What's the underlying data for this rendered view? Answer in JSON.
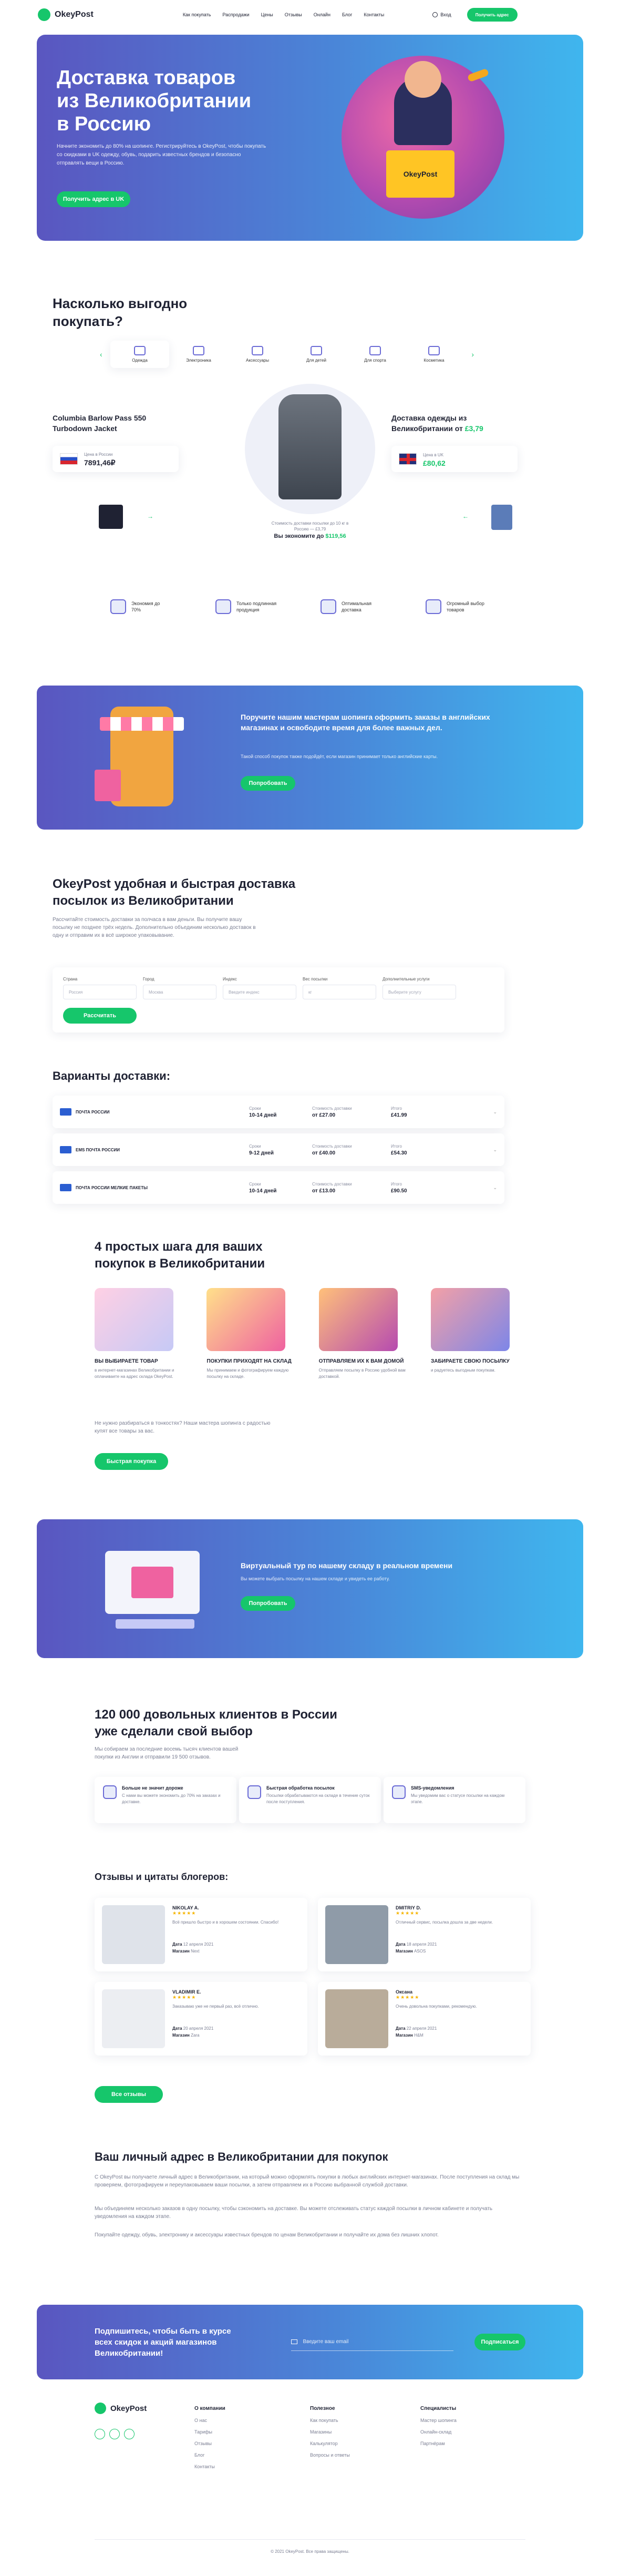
{
  "header": {
    "logo": "OkeyPost",
    "nav": [
      "Как покупать",
      "Распродажи",
      "Цены",
      "Отзывы",
      "Онлайн",
      "Блог",
      "Контакты"
    ],
    "login": "Вход",
    "cta": "Получить адрес"
  },
  "hero": {
    "title_line1": "Доставка товаров",
    "title_line2": "из Великобритании",
    "title_line3": "в Россию",
    "text": "Начните экономить до 80% на шопинге. Регистрируйтесь в OkeyPost, чтобы покупать со скидками в UK одежду, обувь, подарить известных брендов и безопасно отправлять вещи в Россию.",
    "cta": "Получить адрес в UK",
    "box_label": "OkeyPost"
  },
  "profit": {
    "title_line1": "Насколько выгодно",
    "title_line2": "покупать?",
    "categories": [
      "Одежда",
      "Электроника",
      "Аксессуары",
      "Для детей",
      "Для спорта",
      "Косметика"
    ],
    "product_name": "Columbia Barlow Pass 550 Turbodown Jacket",
    "ru_price_label": "Цена в России",
    "ru_price": "7891,46₽",
    "uk_label": "Доставка одежды из Великобритании от",
    "uk_from": "£3,79",
    "uk_price_label": "Цена в UK",
    "uk_price": "£80,62",
    "compare_note": "Стоимость доставки посылки до 10 кг в Россию — £3,79",
    "savings_label": "Вы экономите до",
    "savings": "$119,56"
  },
  "features": [
    "Экономия до 70%",
    "Только подлинная продукция",
    "Оптимальная доставка",
    "Огромный выбор товаров"
  ],
  "shopper_banner": {
    "title": "Поручите нашим мастерам шопинга оформить заказы в английских магазинах и освободите время для более важных дел.",
    "text": "Такой способ покупок также подойдёт, если магазин принимает только английские карты.",
    "cta": "Попробовать"
  },
  "calculator": {
    "title_line1": "OkeyPost удобная и быстрая доставка",
    "title_line2": "посылок из Великобритании",
    "text": "Рассчитайте стоимость доставки за полчаса в вам деньги. Вы получите вашу посылку не позднее трёх недель. Дополнительно объединим несколько доставок в одну и отправим их в всё широкое упаковывание.",
    "fields": [
      {
        "label": "Страна",
        "placeholder": "Россия"
      },
      {
        "label": "Город",
        "placeholder": "Москва"
      },
      {
        "label": "Индекс",
        "placeholder": "Введите индекс"
      },
      {
        "label": "Вес посылки",
        "placeholder": "кг"
      },
      {
        "label": "Дополнительные услуги",
        "placeholder": "Выберите услугу"
      }
    ],
    "cta": "Рассчитать"
  },
  "delivery": {
    "title": "Варианты доставки:",
    "headers": {
      "term": "Сроки",
      "cost": "Стоимость доставки",
      "total": "Итого"
    },
    "rows": [
      {
        "name": "ПОЧТА РОССИИ",
        "term": "10-14 дней",
        "cost": "от £27.00",
        "total": "£41.99"
      },
      {
        "name": "EMS ПОЧТА РОССИИ",
        "term": "9-12 дней",
        "cost": "от £40.00",
        "total": "£54.30"
      },
      {
        "name": "ПОЧТА РОССИИ МЕЛКИЕ ПАКЕТЫ",
        "term": "10-14 дней",
        "cost": "от £13.00",
        "total": "£90.50"
      }
    ]
  },
  "steps": {
    "title_line1": "4 простых шага для ваших",
    "title_line2": "покупок в Великобритании",
    "items": [
      {
        "title": "ВЫ ВЫБИРАЕТЕ ТОВАР",
        "text": "в интернет-магазинах Великобритании и оплачиваете на адрес склада OkeyPost."
      },
      {
        "title": "ПОКУПКИ ПРИХОДЯТ НА СКЛАД",
        "text": "Мы принимаем и фотографируем каждую посылку на складе."
      },
      {
        "title": "ОТПРАВЛЯЕМ ИХ К ВАМ ДОМОЙ",
        "text": "Отправляем посылку в Россию удобной вам доставкой."
      },
      {
        "title": "ЗАБИРАЕТЕ СВОЮ ПОСЫЛКУ",
        "text": "и радуетесь выгодным покупкам."
      }
    ],
    "note": "Не нужно разбираться в тонкостях? Наши мастера шопинга с радостью купят все товары за вас.",
    "cta": "Быстрая покупка"
  },
  "tour_banner": {
    "title": "Виртуальный тур по нашему складу в реальном времени",
    "text": "Вы можете выбрать посылку на нашем складе и увидеть ее работу.",
    "cta": "Попробовать"
  },
  "clients": {
    "title_line1": "120 000 довольных клиентов в России",
    "title_line2": "уже сделали свой выбор",
    "text": "Мы собираем за последние восемь тысяч клиентов вашей покупки из Англии и отправили 19 500 отзывов.",
    "advantages": [
      {
        "title": "Больше не значит дороже",
        "text": "С нами вы можете экономить до 70% на заказах и доставке."
      },
      {
        "title": "Быстрая обработка посылок",
        "text": "Посылки обрабатываются на складе в течение суток после поступления."
      },
      {
        "title": "SMS-уведомления",
        "text": "Мы уведомим вас о статусе посылки на каждом этапе."
      }
    ]
  },
  "reviews": {
    "title": "Отзывы и цитаты блогеров:",
    "items": [
      {
        "name": "NIKOLAY A.",
        "text": "Всё пришло быстро и в хорошем состоянии. Спасибо!",
        "date": "12 апреля 2021",
        "shop": "Next"
      },
      {
        "name": "DMITRIY D.",
        "text": "Отличный сервис, посылка дошла за две недели.",
        "date": "18 апреля 2021",
        "shop": "ASOS"
      },
      {
        "name": "VLADIMIR E.",
        "text": "Заказываю уже не первый раз, всё отлично.",
        "date": "20 апреля 2021",
        "shop": "Zara"
      },
      {
        "name": "Оксана",
        "text": "Очень довольна покупками, рекомендую.",
        "date": "22 апреля 2021",
        "shop": "H&M"
      }
    ],
    "date_label": "Дата",
    "shop_label": "Магазин",
    "cta": "Все отзывы"
  },
  "address": {
    "title": "Ваш личный адрес в Великобритании для покупок",
    "p1": "С OkeyPost вы получаете личный адрес в Великобритании, на который можно оформлять покупки в любых английских интернет-магазинах. После поступления на склад мы проверяем, фотографируем и переупаковываем ваши посылки, а затем отправляем их в Россию выбранной службой доставки.",
    "p2": "Мы объединяем несколько заказов в одну посылку, чтобы сэкономить на доставке. Вы можете отслеживать статус каждой посылки в личном кабинете и получать уведомления на каждом этапе.",
    "p3": "Покупайте одежду, обувь, электронику и аксессуары известных брендов по ценам Великобритании и получайте их дома без лишних хлопот."
  },
  "subscribe": {
    "title": "Подпишитесь, чтобы быть в курсе всех скидок и акций магазинов Великобритании!",
    "placeholder": "Введите ваш email",
    "cta": "Подписаться"
  },
  "footer": {
    "logo": "OkeyPost",
    "cols": [
      {
        "title": "О компании",
        "items": [
          "О нас",
          "Тарифы",
          "Отзывы",
          "Блог",
          "Контакты"
        ]
      },
      {
        "title": "Полезное",
        "items": [
          "Как покупать",
          "Магазины",
          "Калькулятор",
          "Вопросы и ответы"
        ]
      },
      {
        "title": "Специалисты",
        "items": [
          "Мастер шопинга",
          "Онлайн-склад",
          "Партнёрам"
        ]
      }
    ],
    "copyright": "© 2021 OkeyPost. Все права защищены."
  }
}
